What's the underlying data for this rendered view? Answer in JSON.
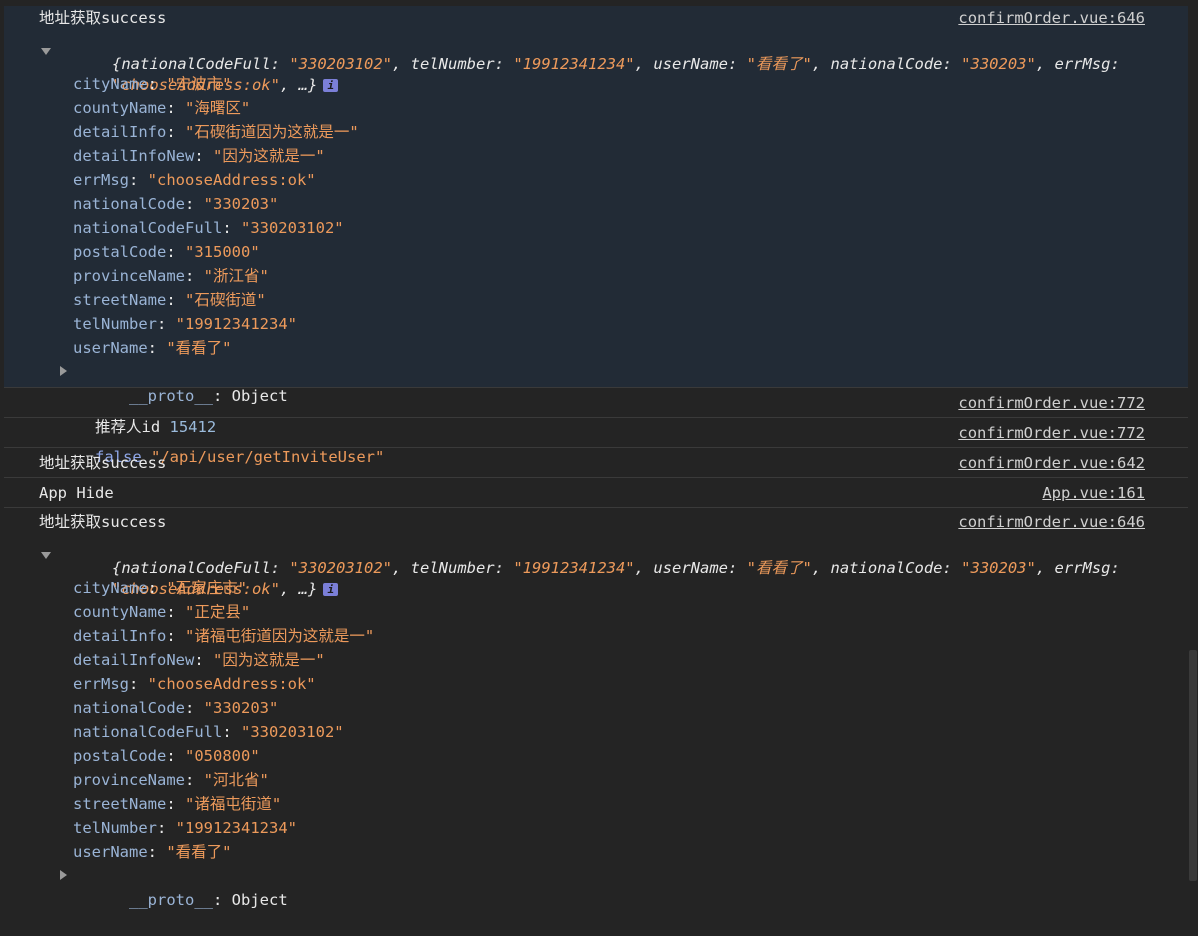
{
  "objects": [
    {
      "title": "地址获取success",
      "source": "confirmOrder.vue:646",
      "preview": {
        "line1": [
          [
            "nationalCodeFull",
            "\"330203102\""
          ],
          [
            "telNumber",
            "\"19912341234\""
          ],
          [
            "userName",
            "\"看看了\""
          ],
          [
            "nationalCode",
            "\"330203\""
          ]
        ],
        "line1_last_key": "errMsg",
        "line2_value": "\"chooseAddress:ok\"",
        "line2_tail": ", …}",
        "open_brace": "{",
        "info_glyph": "i"
      },
      "props": [
        {
          "key": "cityName",
          "value": "\"宁波市\""
        },
        {
          "key": "countyName",
          "value": "\"海曙区\""
        },
        {
          "key": "detailInfo",
          "value": "\"石碶街道因为这就是一\""
        },
        {
          "key": "detailInfoNew",
          "value": "\"因为这就是一\""
        },
        {
          "key": "errMsg",
          "value": "\"chooseAddress:ok\""
        },
        {
          "key": "nationalCode",
          "value": "\"330203\""
        },
        {
          "key": "nationalCodeFull",
          "value": "\"330203102\""
        },
        {
          "key": "postalCode",
          "value": "\"315000\""
        },
        {
          "key": "provinceName",
          "value": "\"浙江省\""
        },
        {
          "key": "streetName",
          "value": "\"石碶街道\""
        },
        {
          "key": "telNumber",
          "value": "\"19912341234\""
        },
        {
          "key": "userName",
          "value": "\"看看了\""
        }
      ],
      "proto_key": "__proto__",
      "proto_value": "Object"
    },
    {
      "title": "地址获取success",
      "source": "confirmOrder.vue:646",
      "preview": {
        "line1": [
          [
            "nationalCodeFull",
            "\"330203102\""
          ],
          [
            "telNumber",
            "\"19912341234\""
          ],
          [
            "userName",
            "\"看看了\""
          ],
          [
            "nationalCode",
            "\"330203\""
          ]
        ],
        "line1_last_key": "errMsg",
        "line2_value": "\"chooseAddress:ok\"",
        "line2_tail": ", …}",
        "open_brace": "{",
        "info_glyph": "i"
      },
      "props": [
        {
          "key": "cityName",
          "value": "\"石家庄市\""
        },
        {
          "key": "countyName",
          "value": "\"正定县\""
        },
        {
          "key": "detailInfo",
          "value": "\"诸福屯街道因为这就是一\""
        },
        {
          "key": "detailInfoNew",
          "value": "\"因为这就是一\""
        },
        {
          "key": "errMsg",
          "value": "\"chooseAddress:ok\""
        },
        {
          "key": "nationalCode",
          "value": "\"330203\""
        },
        {
          "key": "nationalCodeFull",
          "value": "\"330203102\""
        },
        {
          "key": "postalCode",
          "value": "\"050800\""
        },
        {
          "key": "provinceName",
          "value": "\"河北省\""
        },
        {
          "key": "streetName",
          "value": "\"诸福屯街道\""
        },
        {
          "key": "telNumber",
          "value": "\"19912341234\""
        },
        {
          "key": "userName",
          "value": "\"看看了\""
        }
      ],
      "proto_key": "__proto__",
      "proto_value": "Object"
    }
  ],
  "simple": [
    {
      "label": "推荐人id",
      "value": "15412",
      "source": "confirmOrder.vue:772"
    },
    {
      "bool": "false",
      "value": "\"/api/user/getInviteUser\"",
      "source": "confirmOrder.vue:772"
    },
    {
      "label": "地址获取success",
      "source": "confirmOrder.vue:642"
    },
    {
      "label": "App Hide",
      "source": "App.vue:161"
    }
  ]
}
